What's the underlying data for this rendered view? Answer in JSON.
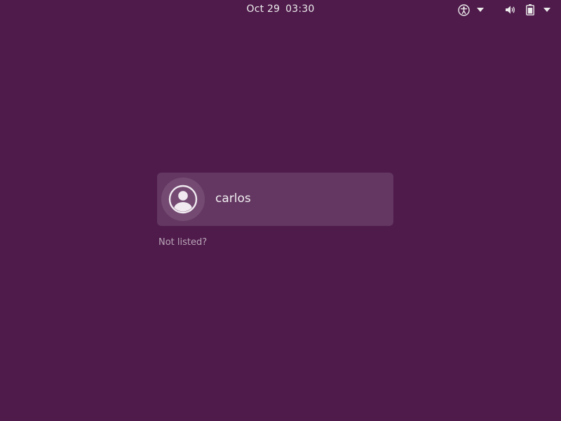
{
  "top_bar": {
    "date": "Oct 29",
    "time": "03:30",
    "icons": [
      "accessibility-icon",
      "chevron-down-icon",
      "volume-icon",
      "battery-icon",
      "chevron-down-icon"
    ]
  },
  "login": {
    "user": {
      "name": "carlos",
      "avatar": "user-avatar-icon"
    },
    "not_listed_label": "Not listed?"
  },
  "colors": {
    "background": "#4f1b4b",
    "card": "#633761",
    "avatar_ring": "#744a72",
    "text": "#ececec",
    "muted_text": "#b9a6b8"
  }
}
